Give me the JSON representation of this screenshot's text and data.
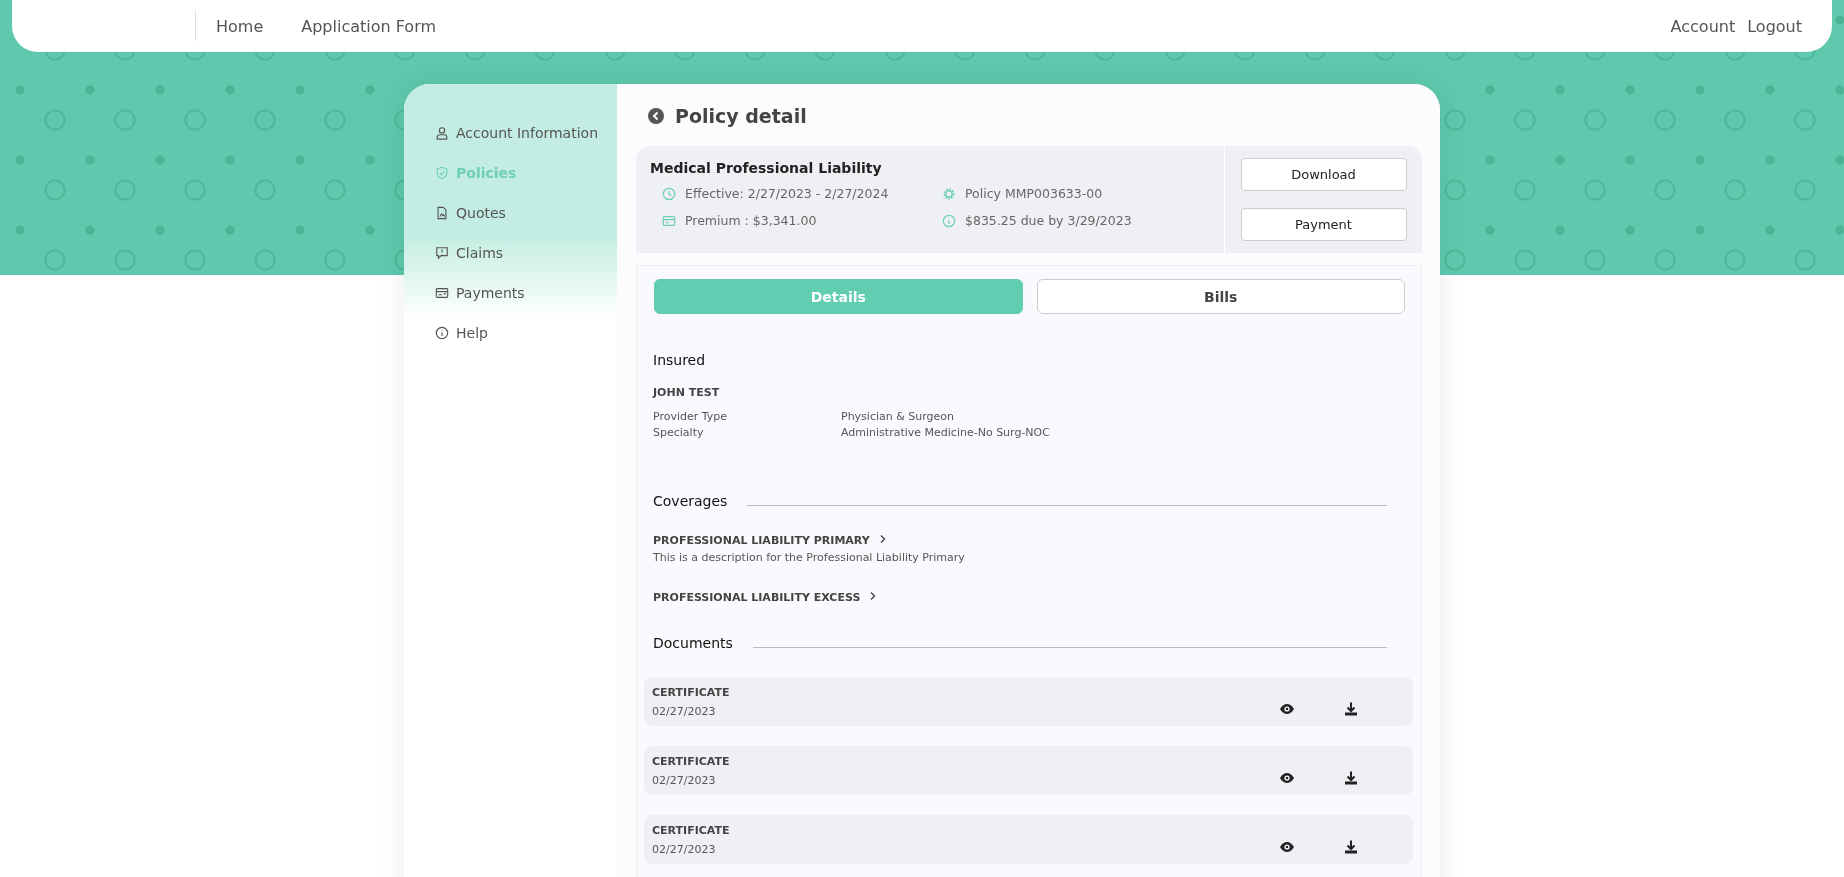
{
  "nav": {
    "links": [
      {
        "label": "Home"
      },
      {
        "label": "Application Form"
      }
    ],
    "right_links": [
      {
        "label": "Account"
      },
      {
        "label": "Logout"
      }
    ]
  },
  "sidebar": {
    "items": [
      {
        "label": "Account Information",
        "kind": "user",
        "selected": false
      },
      {
        "label": "Policies",
        "kind": "shield",
        "selected": true
      },
      {
        "label": "Quotes",
        "kind": "document",
        "selected": false
      },
      {
        "label": "Claims",
        "kind": "alert",
        "selected": false
      },
      {
        "label": "Payments",
        "kind": "card",
        "selected": false
      },
      {
        "label": "Help",
        "kind": "info",
        "selected": false
      }
    ]
  },
  "page_title": "Policy detail",
  "policy": {
    "name": "Medical Professional Liability",
    "facts": [
      {
        "kind": "clock",
        "text": "Effective: 2/27/2023 - 2/27/2024"
      },
      {
        "kind": "gear",
        "text": "Policy MMP003633-00"
      },
      {
        "kind": "card",
        "text": "Premium : $3,341.00"
      },
      {
        "kind": "info",
        "text": "$835.25 due by 3/29/2023"
      }
    ],
    "buttons": [
      "Download",
      "Payment"
    ]
  },
  "tabs": [
    {
      "label": "Details",
      "selected": true
    },
    {
      "label": "Bills",
      "selected": false
    }
  ],
  "insured": {
    "heading": "Insured",
    "name": "JOHN TEST",
    "fields": [
      {
        "label": "Provider Type",
        "value": "Physician & Surgeon"
      },
      {
        "label": "Specialty",
        "value": "Administrative Medicine-No Surg-NOC"
      }
    ]
  },
  "coverages": {
    "heading": "Coverages",
    "items": [
      {
        "title": "PROFESSIONAL LIABILITY PRIMARY",
        "description": "This is a description for the Professional Liability Primary"
      },
      {
        "title": "PROFESSIONAL LIABILITY EXCESS"
      }
    ]
  },
  "documents": {
    "heading": "Documents",
    "items": [
      {
        "title": "CERTIFICATE",
        "date": "02/27/2023"
      },
      {
        "title": "CERTIFICATE",
        "date": "02/27/2023"
      },
      {
        "title": "CERTIFICATE",
        "date": "02/27/2023"
      }
    ]
  }
}
